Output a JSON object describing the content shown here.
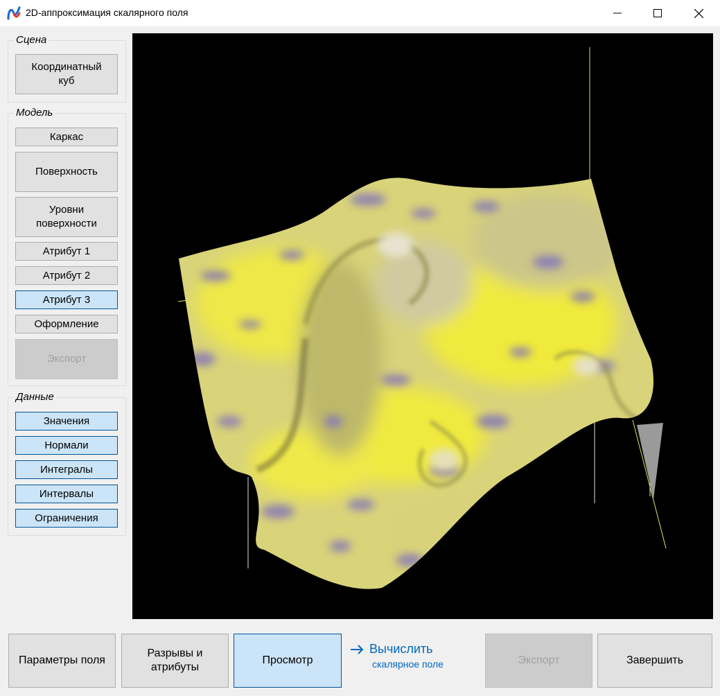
{
  "window": {
    "title": "2D-аппроксимация скалярного поля",
    "controls": {
      "minimize": "minimize-icon",
      "maximize": "maximize-icon",
      "close": "close-icon"
    }
  },
  "sidebar": {
    "scene": {
      "legend": "Сцена",
      "coord_cube": "Координатный куб"
    },
    "model": {
      "legend": "Модель",
      "items": [
        {
          "label": "Каркас"
        },
        {
          "label": "Поверхность"
        },
        {
          "label": "Уровни поверхности"
        },
        {
          "label": "Атрибут 1"
        },
        {
          "label": "Атрибут 2"
        },
        {
          "label": "Атрибут 3",
          "selected": true
        },
        {
          "label": "Оформление"
        },
        {
          "label": "Экспорт",
          "disabled": true
        }
      ]
    },
    "data": {
      "legend": "Данные",
      "items": [
        {
          "label": "Значения"
        },
        {
          "label": "Нормали"
        },
        {
          "label": "Интегралы"
        },
        {
          "label": "Интервалы"
        },
        {
          "label": "Ограничения"
        }
      ]
    }
  },
  "bottom": {
    "field_params": "Параметры поля",
    "gaps_attrs": "Разрывы и атрибуты",
    "view": "Просмотр",
    "compute_main": "Вычислить",
    "compute_sub": "скалярное поле",
    "export": "Экспорт",
    "finish": "Завершить"
  },
  "colors": {
    "surface_yellow": "#e8e24a",
    "surface_violet": "#8a7fbf",
    "viewport_bg": "#000000",
    "accent": "#0067c0",
    "selected_bg": "#cce4f7"
  }
}
